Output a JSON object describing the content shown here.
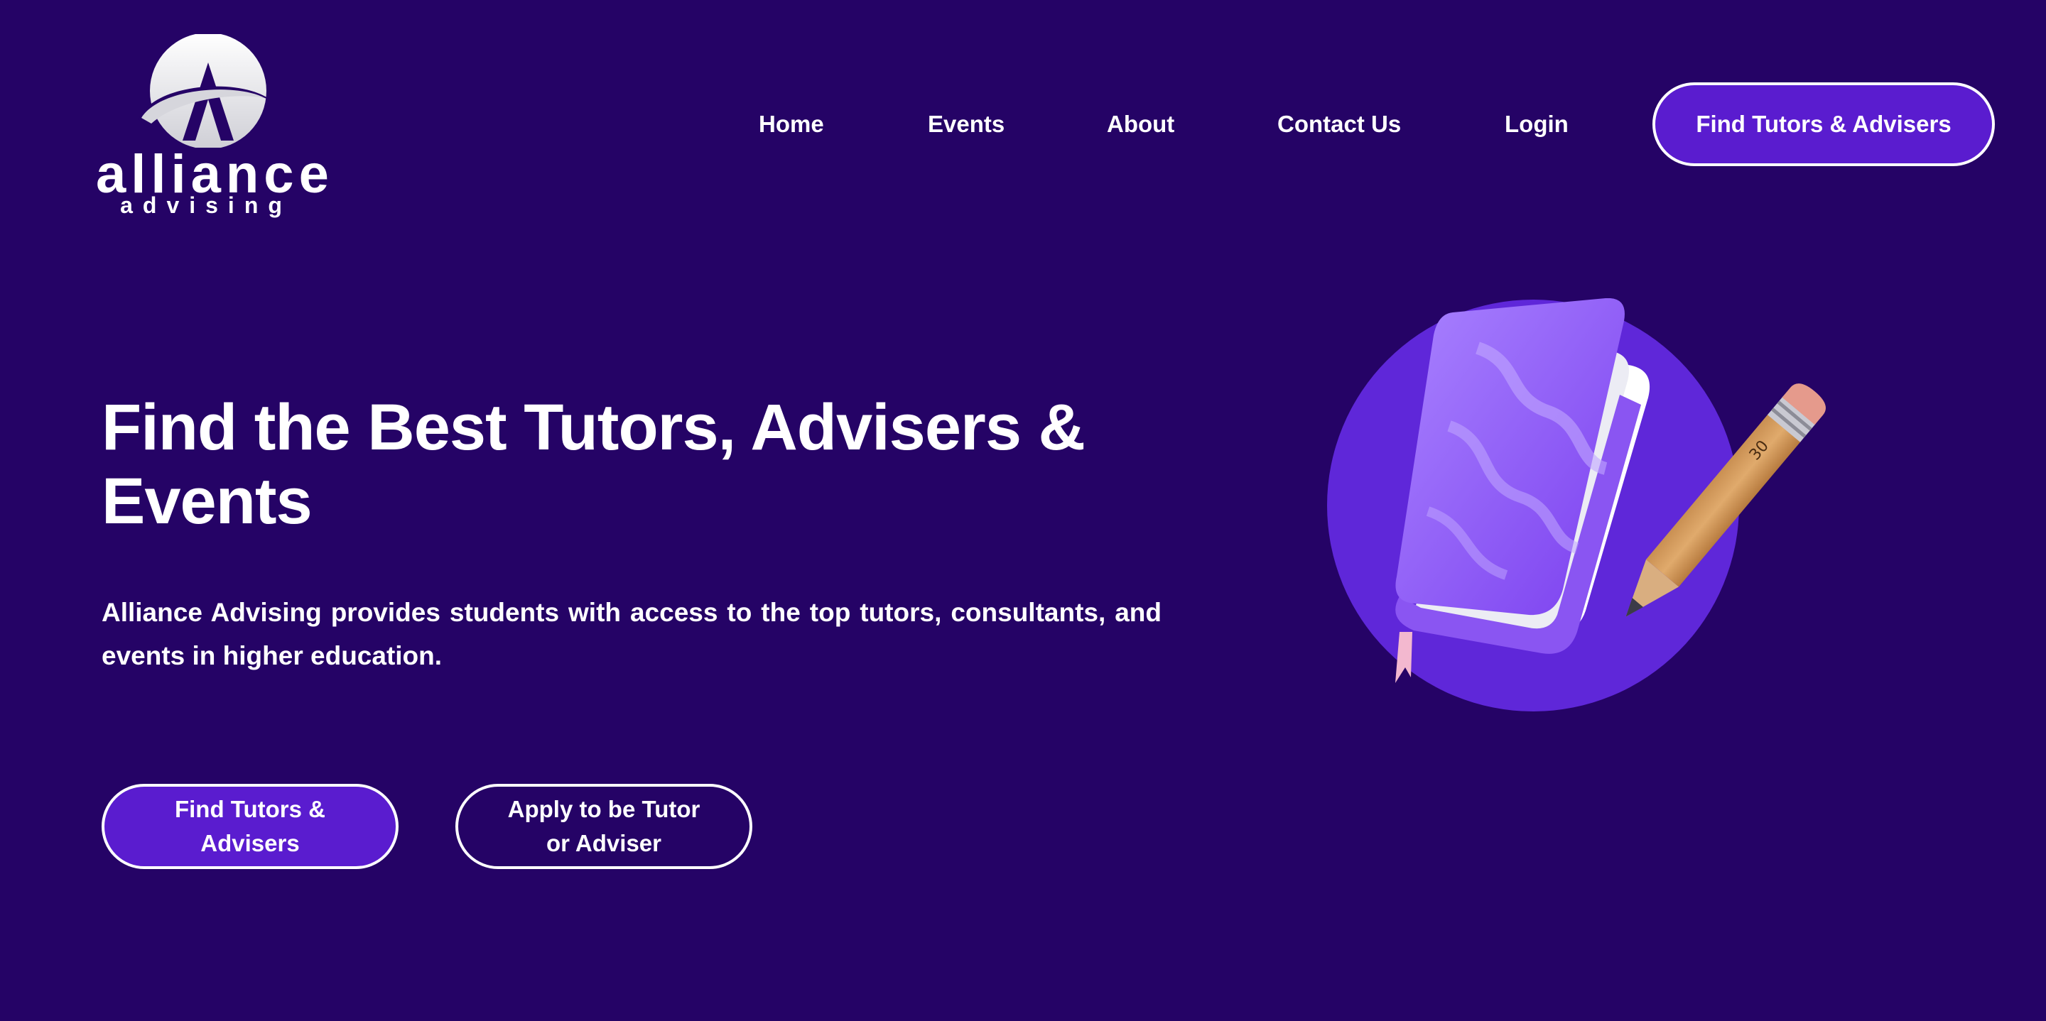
{
  "brand": {
    "logo_word": "alliance",
    "logo_sub": "advising",
    "colors": {
      "background": "#250366",
      "accent": "#5a1ccf",
      "illustration_circle": "#5f27d9",
      "text": "#ffffff"
    }
  },
  "nav": {
    "items": [
      {
        "label": "Home"
      },
      {
        "label": "Events"
      },
      {
        "label": "About"
      },
      {
        "label": "Contact Us"
      },
      {
        "label": "Login"
      }
    ],
    "cta_label": "Find Tutors & Advisers"
  },
  "hero": {
    "title": "Find the Best Tutors, Advisers & Events",
    "description": "Alliance Advising provides students with access to the top tutors, consultants, and events in higher education.",
    "primary_button": "Find Tutors & Advisers",
    "secondary_button": "Apply to be Tutor or Adviser"
  },
  "illustration": {
    "icons": [
      "book-icon",
      "pencil-icon"
    ],
    "pencil_label": "30"
  }
}
